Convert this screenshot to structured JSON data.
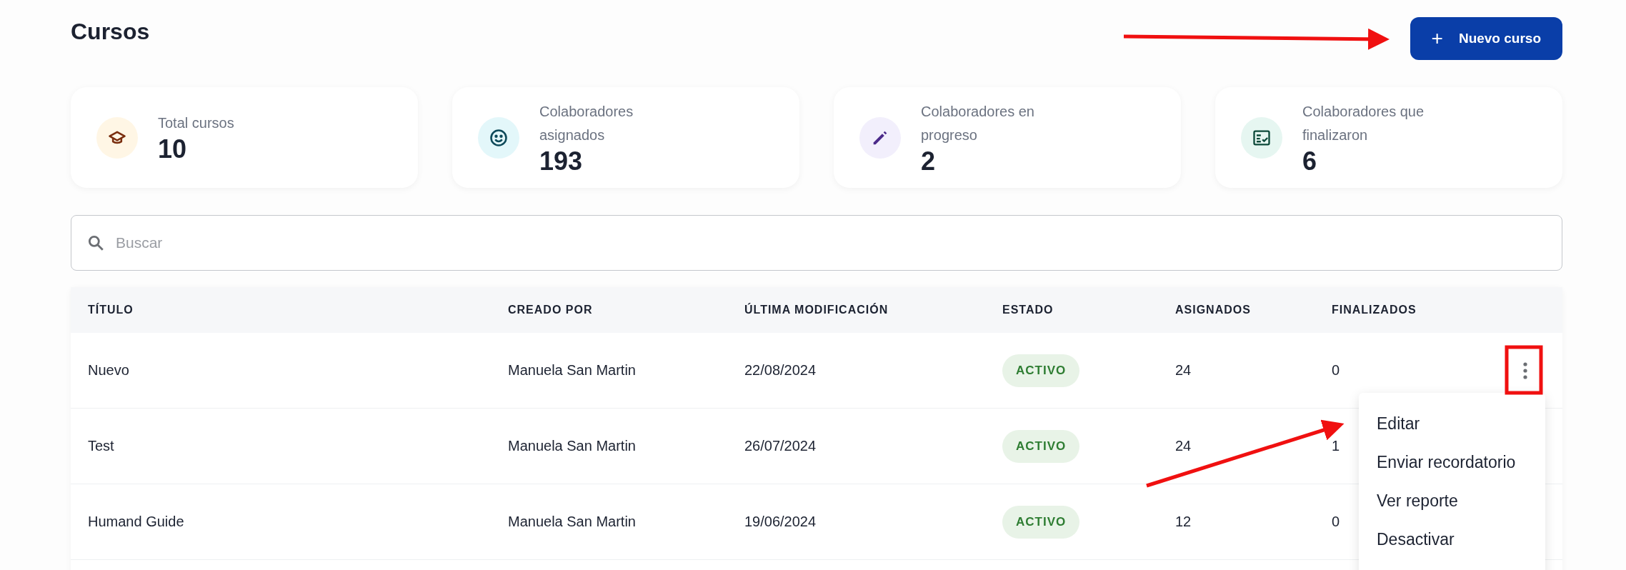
{
  "page": {
    "title": "Cursos"
  },
  "new_button": {
    "icon": "+",
    "label": "Nuevo curso"
  },
  "stats": [
    {
      "kind": "courses",
      "label": "Total cursos",
      "value": "10"
    },
    {
      "kind": "assigned",
      "label": "Colaboradores asignados",
      "value": "193"
    },
    {
      "kind": "progress",
      "label": "Colaboradores en progreso",
      "value": "2"
    },
    {
      "kind": "finished",
      "label": "Colaboradores que finalizaron",
      "value": "6"
    }
  ],
  "search": {
    "placeholder": "Buscar"
  },
  "table": {
    "columns": [
      "TÍTULO",
      "CREADO POR",
      "ÚLTIMA MODIFICACIÓN",
      "ESTADO",
      "ASIGNADOS",
      "FINALIZADOS"
    ],
    "rows": [
      {
        "title": "Nuevo",
        "created_by": "Manuela San Martin",
        "modified": "22/08/2024",
        "status": "ACTIVO",
        "assigned": "24",
        "finished": "0"
      },
      {
        "title": "Test",
        "created_by": "Manuela San Martin",
        "modified": "26/07/2024",
        "status": "ACTIVO",
        "assigned": "24",
        "finished": "1"
      },
      {
        "title": "Humand Guide",
        "created_by": "Manuela San Martin",
        "modified": "19/06/2024",
        "status": "ACTIVO",
        "assigned": "12",
        "finished": "0"
      }
    ]
  },
  "row_menu": {
    "items": [
      "Editar",
      "Enviar recordatorio",
      "Ver reporte",
      "Desactivar"
    ]
  }
}
